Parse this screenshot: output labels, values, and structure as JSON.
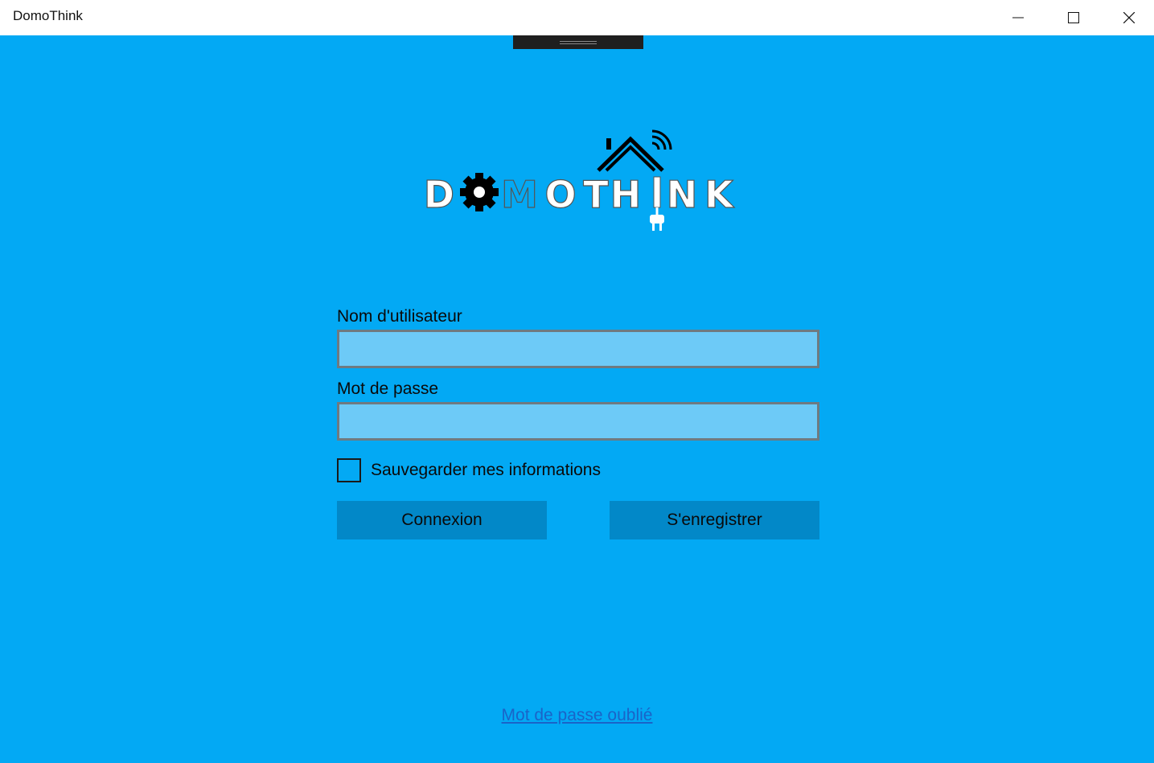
{
  "window": {
    "title": "DomoThink",
    "controls": {
      "minimize_icon": "minimize-icon",
      "maximize_icon": "maximize-icon",
      "close_icon": "close-icon"
    }
  },
  "logo": {
    "text": "DOMOTHINK",
    "icons": [
      "house-roof-icon",
      "wifi-signal-icon",
      "gear-icon",
      "plug-icon"
    ]
  },
  "form": {
    "username_label": "Nom d'utilisateur",
    "username_value": "",
    "password_label": "Mot de passe",
    "password_value": "",
    "remember_label": "Sauvegarder mes informations",
    "remember_checked": false,
    "login_button": "Connexion",
    "register_button": "S'enregistrer"
  },
  "footer": {
    "forgot_password_link": "Mot de passe oublié"
  },
  "colors": {
    "background": "#03a9f4",
    "input_fill": "#6dcaf7",
    "input_border": "#6f7a80",
    "button_fill": "#0288c8",
    "link": "#1a64c8"
  }
}
